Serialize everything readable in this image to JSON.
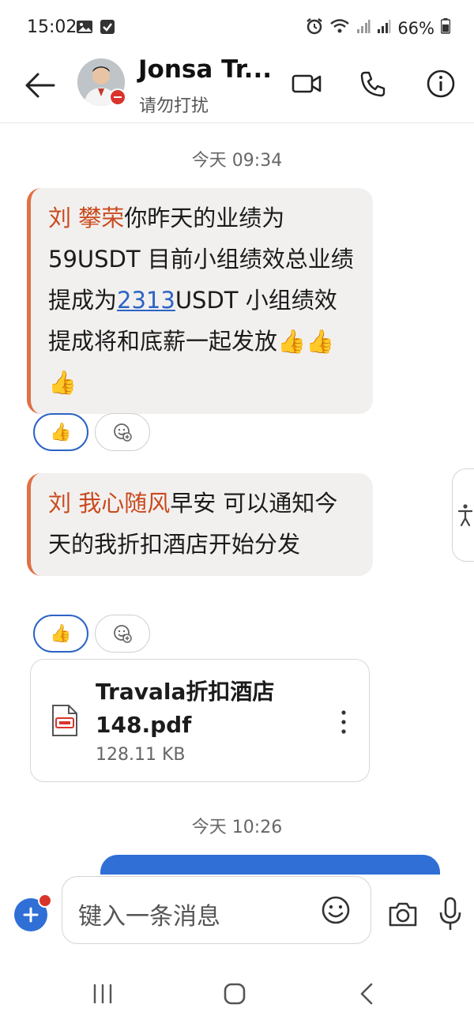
{
  "status_bar": {
    "time": "15:02",
    "battery": "66%",
    "left_icons": [
      "image-icon",
      "checkbox-icon"
    ],
    "right_icons": [
      "alarm-icon",
      "wifi-icon",
      "signal-icon",
      "signal-icon",
      "battery-icon"
    ]
  },
  "header": {
    "contact_name": "Jonsa Tr...",
    "status_text": "请勿打扰",
    "actions": [
      "video-call",
      "voice-call",
      "info"
    ]
  },
  "chat": {
    "timestamp_1": "今天 09:34",
    "message_1": {
      "mention": "刘 攀荣",
      "text_before_link": "你昨天的业绩为59USDT 目前小组绩效总业绩提成为",
      "link_text": "2313",
      "text_after_link": "USDT 小组绩效提成将和底薪一起发放👍👍👍",
      "reaction": "👍"
    },
    "message_2": {
      "mention": "刘 我心随风",
      "text": "早安 可以通知今天的我折扣酒店开始分发",
      "reaction": "👍"
    },
    "file": {
      "name": "Travala折扣酒店148.pdf",
      "size": "128.11 KB"
    },
    "timestamp_2": "今天 10:26"
  },
  "composer": {
    "placeholder": "键入一条消息"
  },
  "colors": {
    "accent_blue": "#2f6fd6",
    "mention_orange": "#c94a1e",
    "quote_bar": "#e07045",
    "bubble_bg": "#f2f0ef",
    "dnd_red": "#d9342b"
  }
}
